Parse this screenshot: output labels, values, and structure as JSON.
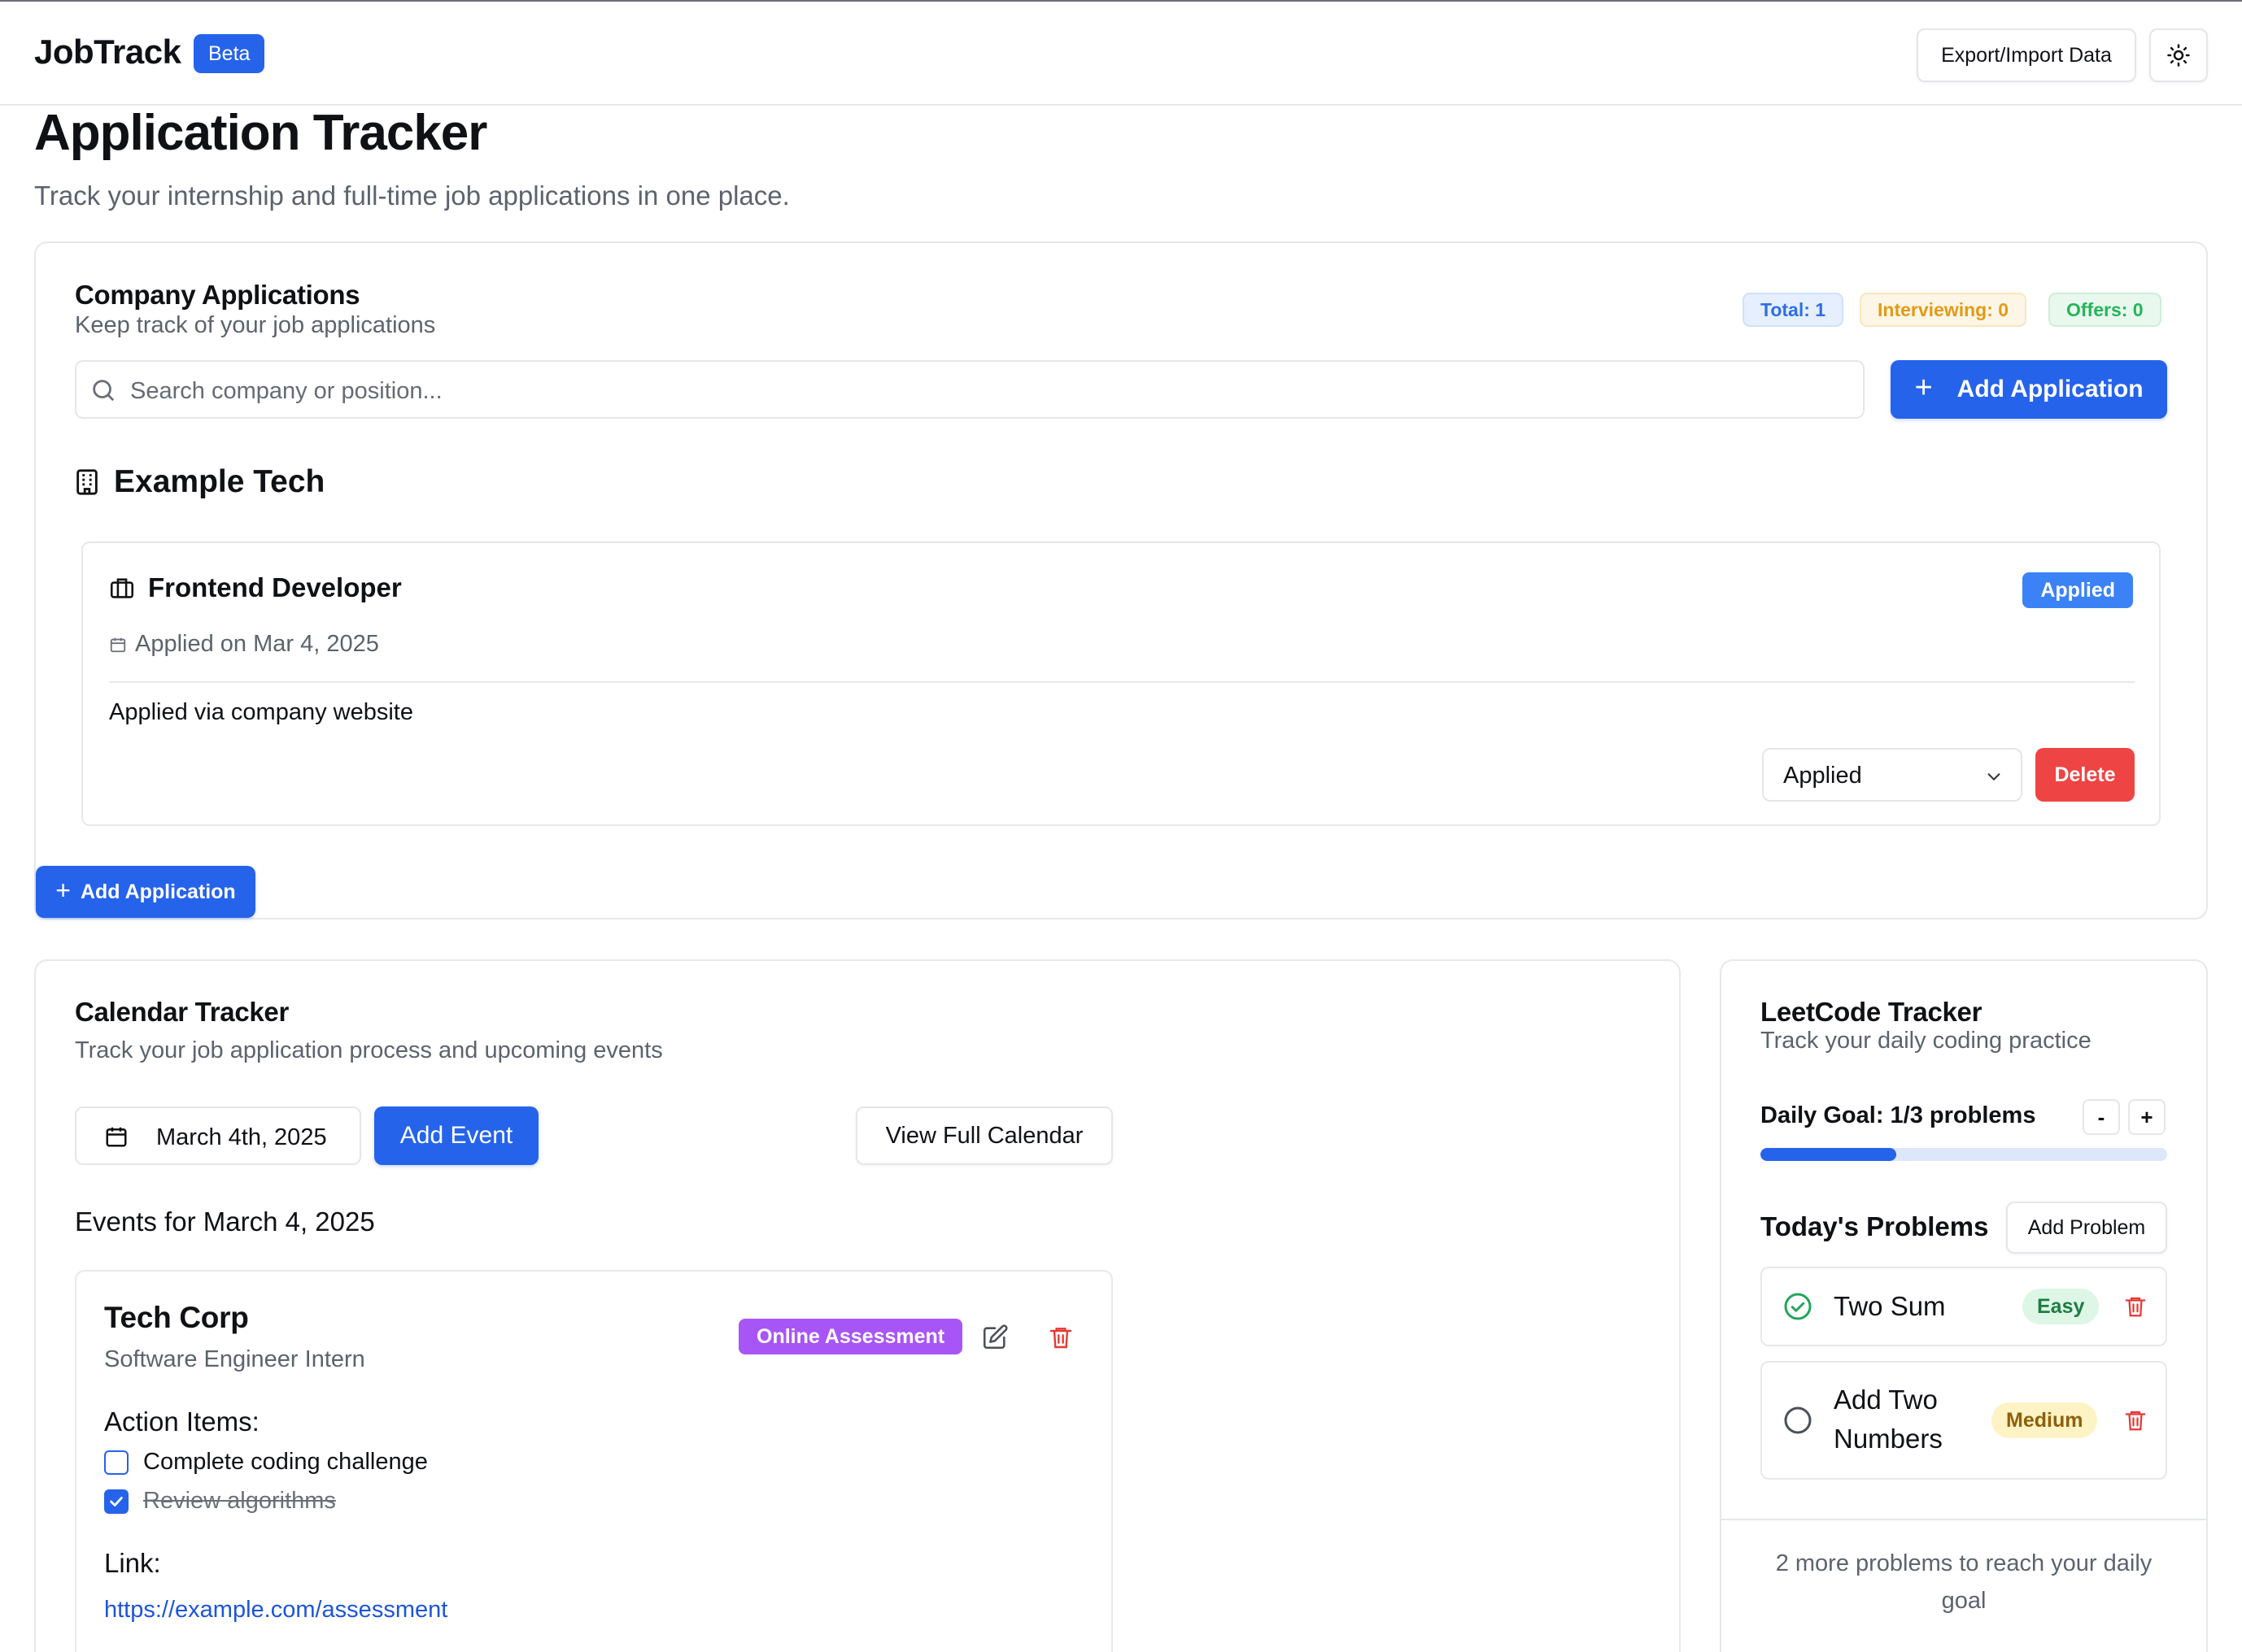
{
  "header": {
    "brand": "JobTrack",
    "badge": "Beta",
    "export_label": "Export/Import Data",
    "theme_icon": "sun-icon"
  },
  "page": {
    "title": "Application Tracker",
    "subtitle": "Track your internship and full-time job applications in one place."
  },
  "applications": {
    "title": "Company Applications",
    "subtitle": "Keep track of your job applications",
    "stats": {
      "total": "Total: 1",
      "interviewing": "Interviewing: 0",
      "offers": "Offers: 0"
    },
    "search_placeholder": "Search company or position...",
    "add_button": "Add Application",
    "add_button_bottom": "Add Application",
    "companies": [
      {
        "name": "Example Tech",
        "roles": [
          {
            "title": "Frontend Developer",
            "status_badge": "Applied",
            "applied_on": "Applied on Mar 4, 2025",
            "note": "Applied via company website",
            "status_select": "Applied",
            "delete_label": "Delete"
          }
        ]
      }
    ]
  },
  "calendar": {
    "title": "Calendar Tracker",
    "subtitle": "Track your job application process and upcoming events",
    "date_value": "March 4th, 2025",
    "add_event": "Add Event",
    "view_full": "View Full Calendar",
    "events_heading": "Events for March 4, 2025",
    "events": [
      {
        "company": "Tech Corp",
        "role": "Software Engineer Intern",
        "type": "Online Assessment",
        "action_items_label": "Action Items:",
        "action_items": [
          {
            "text": "Complete coding challenge",
            "done": false
          },
          {
            "text": "Review algorithms",
            "done": true
          }
        ],
        "link_label": "Link:",
        "link": "https://example.com/assessment"
      }
    ]
  },
  "leetcode": {
    "title": "LeetCode Tracker",
    "subtitle": "Track your daily coding practice",
    "goal_text": "Daily Goal: 1/3 problems",
    "goal_done": 1,
    "goal_total": 3,
    "minus_label": "-",
    "plus_label": "+",
    "today_heading": "Today's Problems",
    "add_problem": "Add Problem",
    "problems": [
      {
        "name": "Two Sum",
        "difficulty": "Easy",
        "completed": true
      },
      {
        "name": "Add Two Numbers",
        "difficulty": "Medium",
        "completed": false
      }
    ],
    "footer": "2 more problems to reach your daily goal"
  },
  "colors": {
    "primary": "#2563eb",
    "danger": "#ef4444",
    "assessment": "#a855f7"
  }
}
